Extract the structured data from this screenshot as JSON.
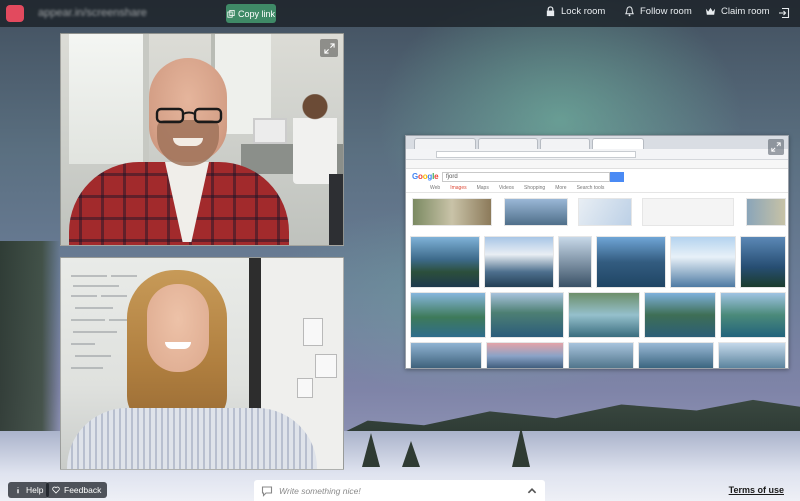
{
  "topbar": {
    "room_name": "appear.in/screenshare",
    "copy_link_label": "Copy link",
    "actions": [
      {
        "label": "Lock room",
        "icon": "lock-icon"
      },
      {
        "label": "Follow room",
        "icon": "bell-icon"
      },
      {
        "label": "Claim room",
        "icon": "crown-icon"
      }
    ],
    "exit_icon": "exit-icon"
  },
  "videos": [
    {
      "participant": "man-in-plaid-shirt",
      "icon": "expand-icon"
    },
    {
      "participant": "woman-in-striped-shirt"
    }
  ],
  "screenshare": {
    "search_logo": "Google",
    "search_query": "fjord",
    "tools": [
      "Web",
      "Images",
      "Maps",
      "Videos",
      "Shopping",
      "More",
      "Search tools"
    ],
    "active_tool": "Images",
    "related_labels": [
      "Norway",
      "Wallpaper",
      "Map",
      "Diagram",
      "Horse Marie"
    ],
    "icon": "expand-icon"
  },
  "bottom": {
    "help_label": "Help",
    "feedback_label": "Feedback",
    "chat_placeholder": "Write something nice!",
    "terms_label": "Terms of use"
  },
  "colors": {
    "topbar_bg": "#1c2228",
    "copy_link_bg": "#3f8a67",
    "logo": "#e24a5e",
    "aurora": "#78c8aa"
  }
}
